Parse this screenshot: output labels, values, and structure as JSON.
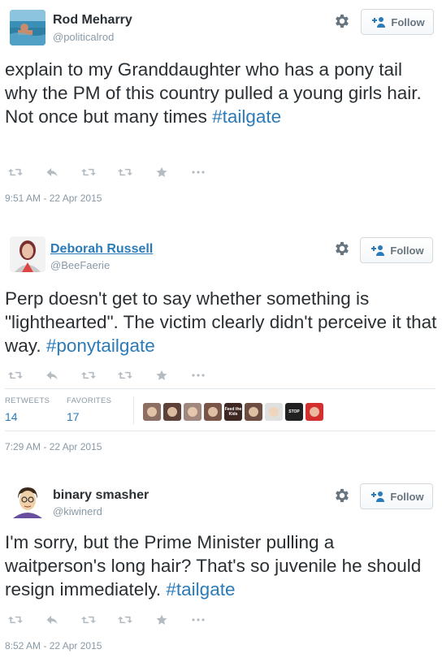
{
  "tweets": [
    {
      "name": "Rod Meharry",
      "handle": "@politicalrod",
      "follow_label": "Follow",
      "text_before": "explain to my Granddaughter who has a pony tail why the PM of this country pulled a young girls hair. Not once but many times ",
      "hashtag": "#tailgate",
      "timestamp": "9:51 AM - 22 Apr 2015"
    },
    {
      "name": "Deborah Russell",
      "handle": "@BeeFaerie",
      "follow_label": "Follow",
      "text_before": "Perp doesn't get to say whether something is \"lighthearted\". The victim clearly didn't perceive it that way. ",
      "hashtag": "#ponytailgate",
      "retweets_label": "RETWEETS",
      "retweets": "14",
      "favorites_label": "FAVORITES",
      "favorites": "17",
      "favoriter_avatars": [
        {
          "color": "#8d6e63"
        },
        {
          "color": "#5d4037"
        },
        {
          "color": "#a1887f"
        },
        {
          "color": "#795548"
        },
        {
          "color": "#3e2723",
          "caption": "Feed the Kids"
        },
        {
          "color": "#6d4c41"
        },
        {
          "color": "#e0e0e0"
        },
        {
          "color": "#212121",
          "caption": "STOP"
        },
        {
          "color": "#d32f2f"
        }
      ],
      "timestamp": "7:29 AM - 22 Apr 2015"
    },
    {
      "name": "binary smasher",
      "handle": "@kiwinerd",
      "follow_label": "Follow",
      "text_before": "I'm sorry, but the Prime Minister pulling a waitperson's long hair? That's so juvenile he should resign immediately. ",
      "hashtag": "#tailgate",
      "timestamp": "8:52 AM - 22 Apr 2015"
    }
  ],
  "icons": [
    "gear-icon",
    "add-user-icon",
    "reply-icon",
    "retweet-icon",
    "favorite-icon",
    "more-icon"
  ],
  "colors": {
    "link": "#2b7bb9",
    "muted": "#8899a6",
    "text": "#292f33",
    "border": "#d3d9de"
  }
}
